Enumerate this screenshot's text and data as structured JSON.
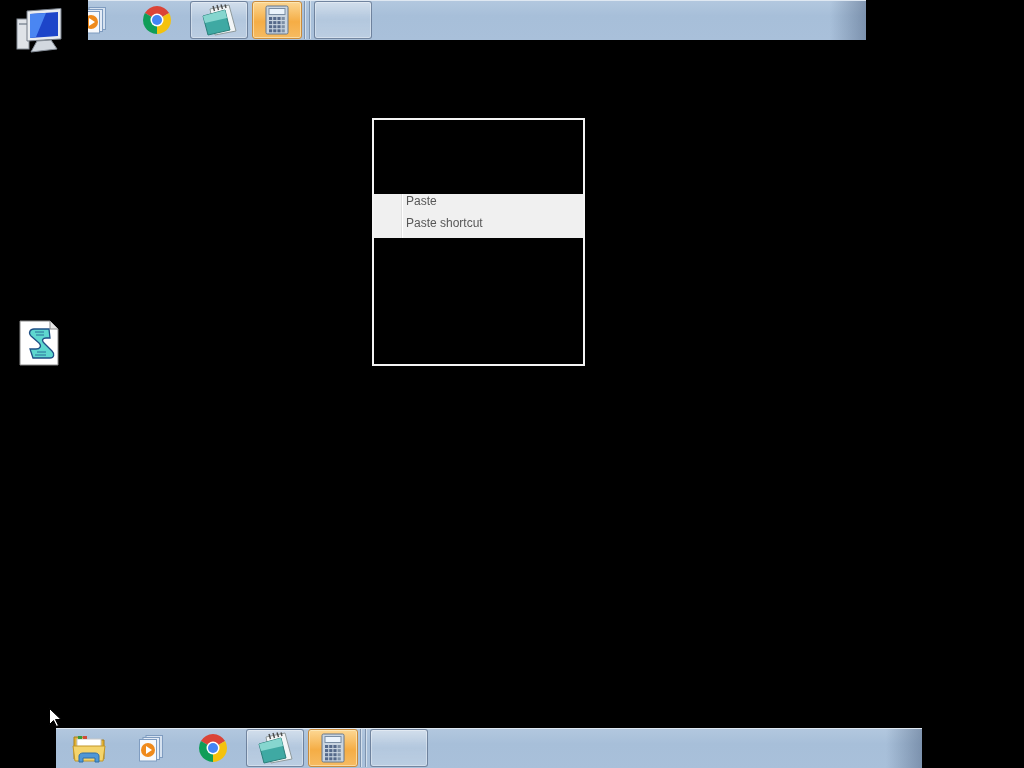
{
  "context_menu": {
    "items": [
      {
        "label": "Paste"
      },
      {
        "label": "Paste shortcut"
      }
    ]
  },
  "taskbars": [
    {
      "buttons": [
        {
          "running": false,
          "selected": false
        },
        {
          "running": false,
          "selected": false
        },
        {
          "running": true,
          "selected": false
        },
        {
          "running": true,
          "selected": true
        },
        {
          "running": true,
          "selected": false
        }
      ]
    },
    {
      "buttons": [
        {
          "running": false,
          "selected": false
        },
        {
          "running": false,
          "selected": false
        },
        {
          "running": false,
          "selected": false
        },
        {
          "running": true,
          "selected": false
        },
        {
          "running": true,
          "selected": true
        },
        {
          "running": true,
          "selected": false
        }
      ]
    }
  ]
}
